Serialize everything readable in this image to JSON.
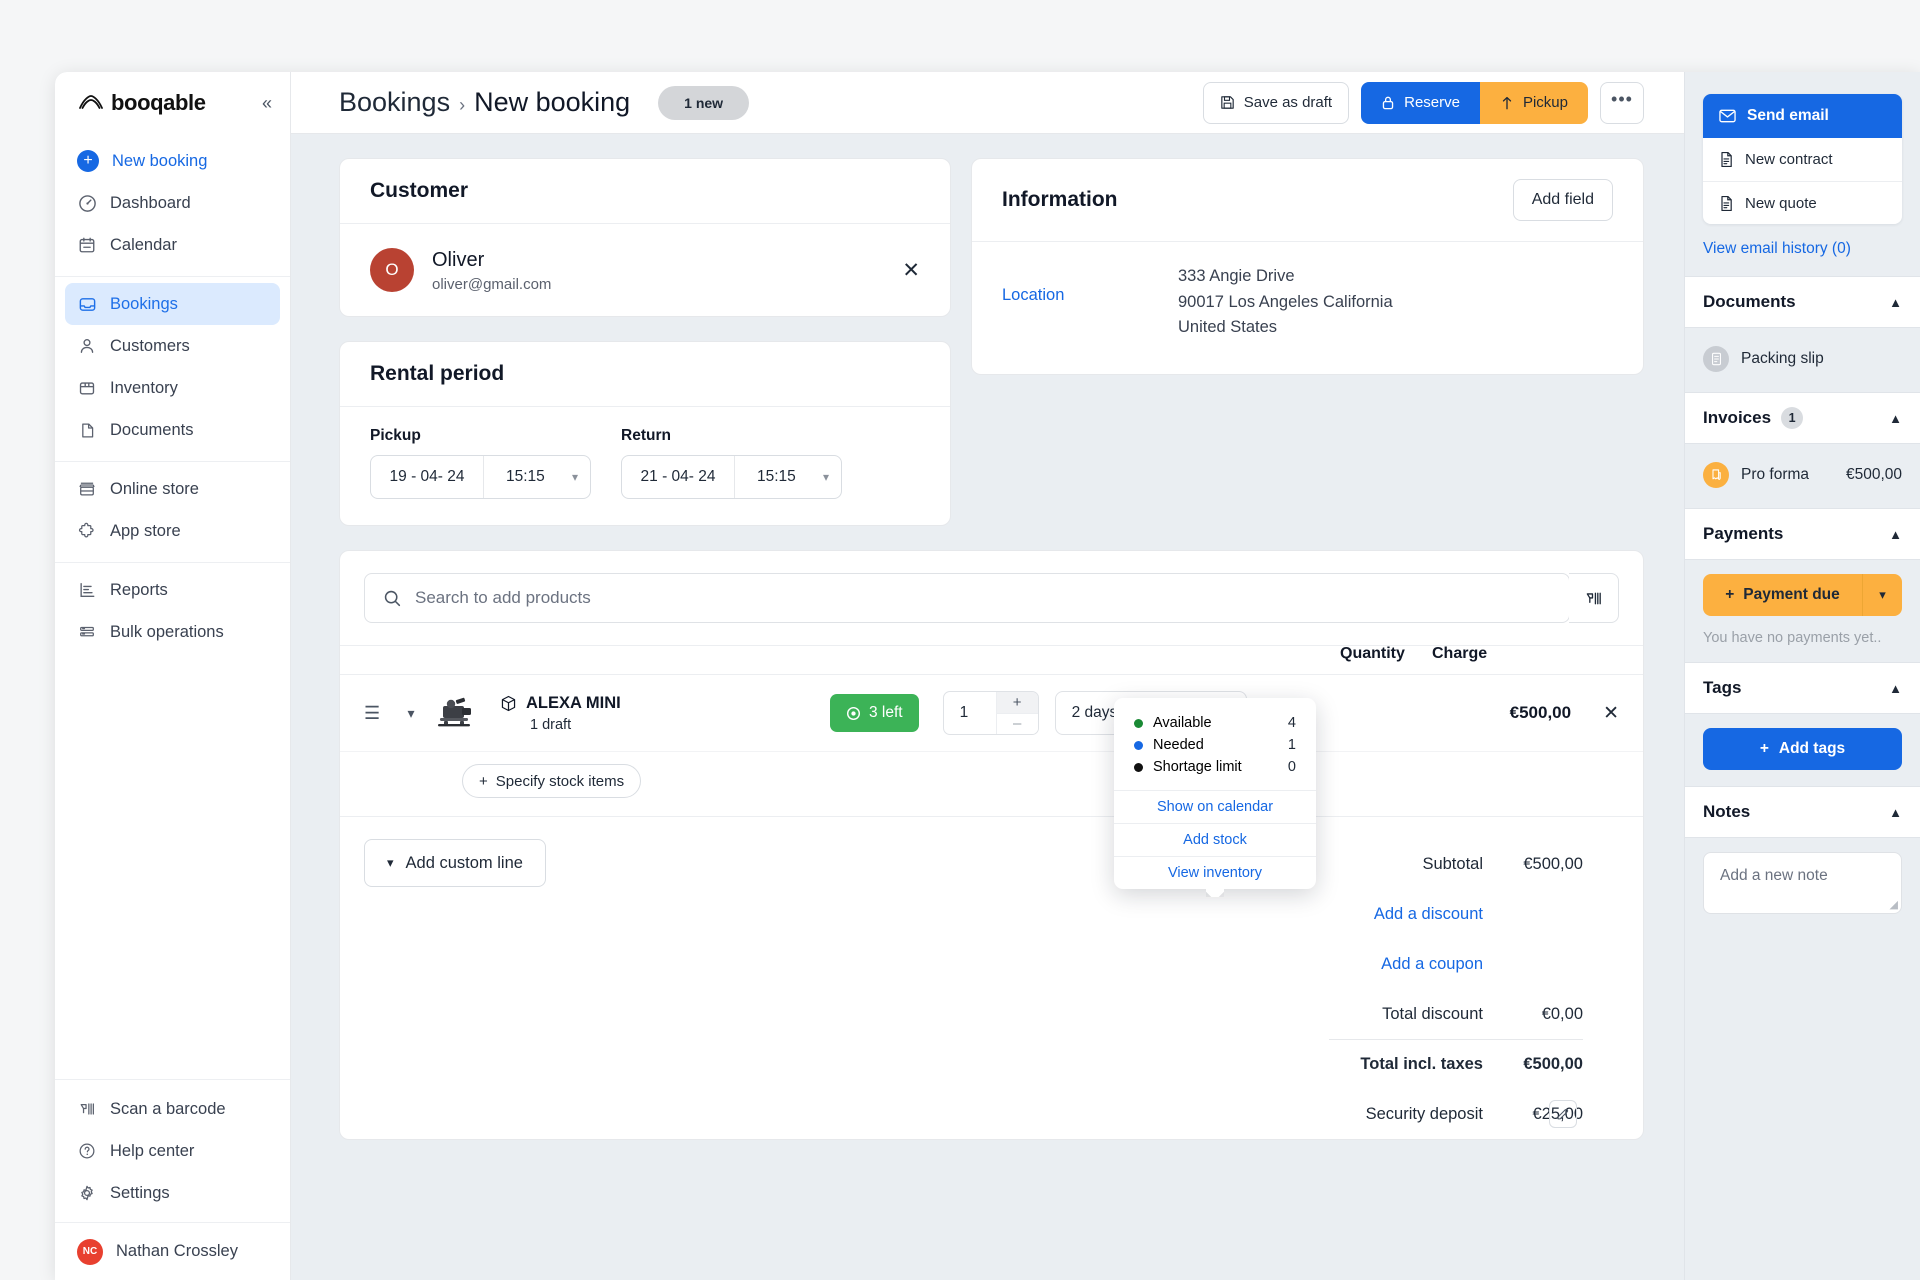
{
  "sidebar": {
    "brand": "booqable",
    "collapse_icon": "chevron-double-left-icon",
    "groups": [
      {
        "items": [
          {
            "label": "New booking",
            "icon": "plus-circle-icon",
            "state": "primary"
          },
          {
            "label": "Dashboard",
            "icon": "gauge-icon",
            "state": "normal"
          },
          {
            "label": "Calendar",
            "icon": "calendar-icon",
            "state": "normal"
          }
        ]
      },
      {
        "items": [
          {
            "label": "Bookings",
            "icon": "inbox-icon",
            "state": "active"
          },
          {
            "label": "Customers",
            "icon": "user-icon",
            "state": "normal"
          },
          {
            "label": "Inventory",
            "icon": "box-icon",
            "state": "normal"
          },
          {
            "label": "Documents",
            "icon": "file-icon",
            "state": "normal"
          }
        ]
      },
      {
        "items": [
          {
            "label": "Online store",
            "icon": "storefront-icon",
            "state": "normal"
          },
          {
            "label": "App store",
            "icon": "puzzle-icon",
            "state": "normal"
          }
        ]
      },
      {
        "items": [
          {
            "label": "Reports",
            "icon": "bar-chart-icon",
            "state": "normal"
          },
          {
            "label": "Bulk operations",
            "icon": "layers-icon",
            "state": "normal"
          }
        ]
      }
    ],
    "bottom_items": [
      {
        "label": "Scan a barcode",
        "icon": "barcode-scanner-icon"
      },
      {
        "label": "Help center",
        "icon": "question-circle-icon"
      },
      {
        "label": "Settings",
        "icon": "gear-icon"
      }
    ],
    "user": {
      "name": "Nathan Crossley",
      "initials": "NC",
      "avatar_color": "#e8402f"
    }
  },
  "topbar": {
    "breadcrumb_root": "Bookings",
    "breadcrumb_sep": "›",
    "breadcrumb_current": "New booking",
    "status_pill": "1 new",
    "save_draft_label": "Save as draft",
    "reserve_label": "Reserve",
    "pickup_label": "Pickup",
    "more_label": "•••",
    "reserve_color": "#1668e3",
    "pickup_color": "#fcb040"
  },
  "customer": {
    "title": "Customer",
    "avatar_initial": "O",
    "avatar_color": "#b94232",
    "name": "Oliver",
    "email": "oliver@gmail.com",
    "remove_icon": "close-icon"
  },
  "rental_period": {
    "title": "Rental period",
    "pickup_label": "Pickup",
    "pickup_date": "19 - 04- 24",
    "pickup_time": "15:15",
    "return_label": "Return",
    "return_date": "21 - 04- 24",
    "return_time": "15:15"
  },
  "information": {
    "title": "Information",
    "add_field_label": "Add field",
    "rows": [
      {
        "label": "Location",
        "value_lines": [
          "333 Angie Drive",
          "90017 Los Angeles California",
          "United States"
        ]
      }
    ]
  },
  "products": {
    "search_placeholder": "Search to add products",
    "search_value": "",
    "barcode_icon": "barcode-scanner-icon",
    "columns": {
      "quantity": "Quantity",
      "charge": "Charge"
    },
    "lines": [
      {
        "name": "ALEXA MINI",
        "sub": "1 draft",
        "stock_badge": "3 left",
        "stock_badge_color": "#3cb357",
        "quantity": "1",
        "charge_period": "2 days",
        "charge_price": "€500,00",
        "total": "€500,00",
        "specify_stock_label": "Specify stock items"
      }
    ],
    "add_custom_line_label": "Add custom line"
  },
  "availability_popover": {
    "stats": [
      {
        "label": "Available",
        "value": "4",
        "color": "#1a8a35"
      },
      {
        "label": "Needed",
        "value": "1",
        "color": "#1668e3"
      },
      {
        "label": "Shortage limit",
        "value": "0",
        "color": "#111111"
      }
    ],
    "links": [
      "Show on calendar",
      "Add stock",
      "View inventory"
    ]
  },
  "totals": [
    {
      "label": "Subtotal",
      "value": "€500,00",
      "type": "plain"
    },
    {
      "label": "Add a discount",
      "value": "",
      "type": "link"
    },
    {
      "label": "Add a coupon",
      "value": "",
      "type": "link"
    },
    {
      "label": "Total discount",
      "value": "€0,00",
      "type": "plain"
    },
    {
      "label": "Total incl. taxes",
      "value": "€500,00",
      "type": "grand"
    },
    {
      "label": "Security deposit",
      "value": "€25,00",
      "type": "deposit"
    }
  ],
  "right_panel": {
    "send_email_label": "Send email",
    "new_contract_label": "New contract",
    "new_quote_label": "New quote",
    "email_history_label": "View email history (0)",
    "documents": {
      "title": "Documents",
      "items": [
        {
          "label": "Packing slip",
          "icon": "document-icon"
        }
      ]
    },
    "invoices": {
      "title": "Invoices",
      "count": "1",
      "items": [
        {
          "label": "Pro forma",
          "amount": "€500,00",
          "icon": "invoice-icon"
        }
      ]
    },
    "payments": {
      "title": "Payments",
      "payment_due_label": "Payment due",
      "empty_text": "You have no payments yet..",
      "button_color": "#fcb040"
    },
    "tags": {
      "title": "Tags",
      "add_label": "Add tags",
      "button_color": "#1668e3"
    },
    "notes": {
      "title": "Notes",
      "placeholder": "Add a new note"
    }
  }
}
